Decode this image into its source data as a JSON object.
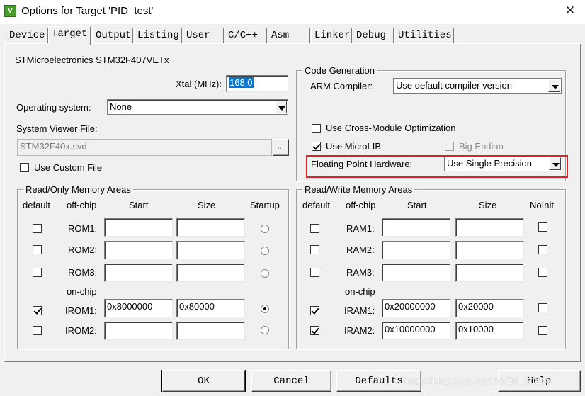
{
  "window": {
    "title": "Options for Target 'PID_test'",
    "icon_letter": "V"
  },
  "tabs": [
    {
      "label": "Device"
    },
    {
      "label": "Target"
    },
    {
      "label": "Output"
    },
    {
      "label": "Listing"
    },
    {
      "label": "User"
    },
    {
      "label": "C/C++"
    },
    {
      "label": "Asm"
    },
    {
      "label": "Linker"
    },
    {
      "label": "Debug"
    },
    {
      "label": "Utilities"
    }
  ],
  "active_tab": "Target",
  "device_name": "STMicroelectronics STM32F407VETx",
  "xtal": {
    "label": "Xtal (MHz):",
    "value": "168.0"
  },
  "os": {
    "label": "Operating system:",
    "value": "None"
  },
  "svd": {
    "label": "System Viewer File:",
    "value": "STM32F40x.svd",
    "browse": "..."
  },
  "custom_file": {
    "label": "Use Custom File",
    "checked": false
  },
  "codegen": {
    "title": "Code Generation",
    "compiler_label": "ARM Compiler:",
    "compiler_value": "Use default compiler version",
    "cross_module": {
      "label": "Use Cross-Module Optimization",
      "checked": false
    },
    "microlib": {
      "label": "Use MicroLIB",
      "checked": true
    },
    "big_endian": {
      "label": "Big Endian",
      "checked": false
    },
    "fpu_label": "Floating Point Hardware:",
    "fpu_value": "Use Single Precision",
    "highlight_color": "#e02020"
  },
  "ro_memory": {
    "title": "Read/Only Memory Areas",
    "headers": {
      "default": "default",
      "offchip": "off-chip",
      "start": "Start",
      "size": "Size",
      "startup": "Startup"
    },
    "onchip_label": "on-chip",
    "rows": [
      {
        "name": "ROM1:",
        "default": false,
        "start": "",
        "size": "",
        "startup": false
      },
      {
        "name": "ROM2:",
        "default": false,
        "start": "",
        "size": "",
        "startup": false
      },
      {
        "name": "ROM3:",
        "default": false,
        "start": "",
        "size": "",
        "startup": false
      },
      {
        "name": "IROM1:",
        "default": true,
        "start": "0x8000000",
        "size": "0x80000",
        "startup": true
      },
      {
        "name": "IROM2:",
        "default": false,
        "start": "",
        "size": "",
        "startup": false
      }
    ]
  },
  "rw_memory": {
    "title": "Read/Write Memory Areas",
    "headers": {
      "default": "default",
      "offchip": "off-chip",
      "start": "Start",
      "size": "Size",
      "noinit": "NoInit"
    },
    "onchip_label": "on-chip",
    "rows": [
      {
        "name": "RAM1:",
        "default": false,
        "start": "",
        "size": "",
        "noinit": false
      },
      {
        "name": "RAM2:",
        "default": false,
        "start": "",
        "size": "",
        "noinit": false
      },
      {
        "name": "RAM3:",
        "default": false,
        "start": "",
        "size": "",
        "noinit": false
      },
      {
        "name": "IRAM1:",
        "default": true,
        "start": "0x20000000",
        "size": "0x20000",
        "noinit": false
      },
      {
        "name": "IRAM2:",
        "default": true,
        "start": "0x10000000",
        "size": "0x10000",
        "noinit": false
      }
    ]
  },
  "buttons": {
    "ok": "OK",
    "cancel": "Cancel",
    "defaults": "Defaults",
    "help": "Help"
  },
  "watermark": "https://blog.csdn.net/OWEN_SODA"
}
